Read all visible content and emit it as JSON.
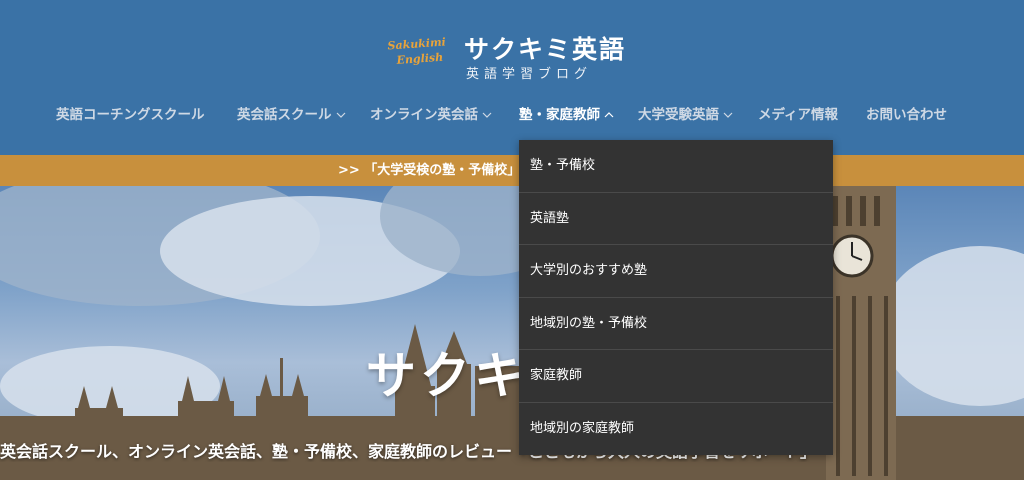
{
  "logo": {
    "script_line1": "Sakukimi",
    "script_line2": "English",
    "title": "サクキミ英語",
    "subtitle": "英語学習ブログ"
  },
  "nav": {
    "items": [
      {
        "label": "英語コーチングスクール",
        "has_dropdown": false
      },
      {
        "label": "英会話スクール",
        "has_dropdown": true
      },
      {
        "label": "オンライン英会話",
        "has_dropdown": true
      },
      {
        "label": "塾・家庭教師",
        "has_dropdown": true,
        "active": true
      },
      {
        "label": "大学受験英語",
        "has_dropdown": true
      },
      {
        "label": "メディア情報",
        "has_dropdown": false
      },
      {
        "label": "お問い合わせ",
        "has_dropdown": false
      }
    ]
  },
  "banner": {
    "text": ">> 「大学受検の塾・予備校」"
  },
  "dropdown": {
    "items": [
      "塾・予備校",
      "英語塾",
      "大学別のおすすめ塾",
      "地域別の塾・予備校",
      "家庭教師",
      "地域別の家庭教師"
    ]
  },
  "hero": {
    "title": "サクキ",
    "subtitle": "英会話スクール、オンライン英会話、塾・予備校、家庭教師のレビュー「こどもから大人の英語学習をサポート」"
  },
  "colors": {
    "header_bg": "#3a72a6",
    "banner_bg": "#c8903d",
    "dropdown_bg": "#333333",
    "logo_accent": "#e8a33a"
  }
}
